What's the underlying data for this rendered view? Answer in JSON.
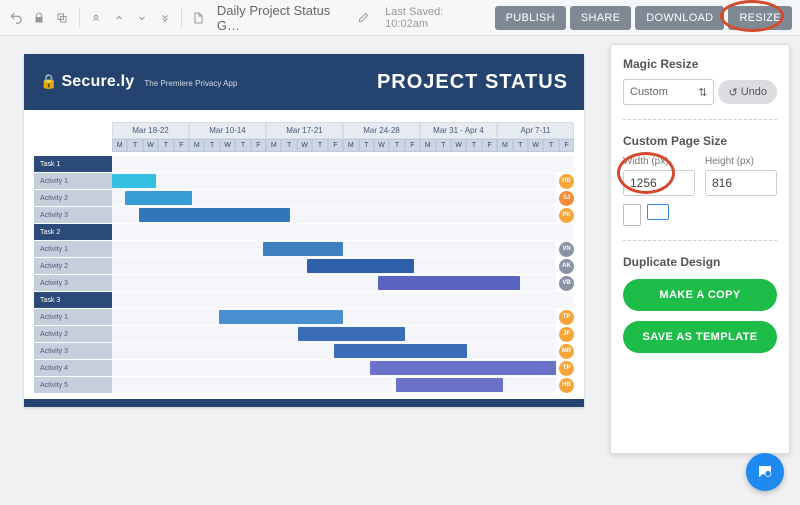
{
  "topbar": {
    "file_title": "Daily Project Status G…",
    "last_saved_label": "Last Saved:",
    "last_saved_time": "10:02am",
    "actions": {
      "publish": "PUBLISH",
      "share": "SHARE",
      "download": "DOWNLOAD",
      "resize": "RESIZE"
    }
  },
  "canvas": {
    "brand_name": "Secure.ly",
    "brand_tagline": "The Premiere Privacy App",
    "title": "PROJECT STATUS",
    "weeks": [
      "Mar 18-22",
      "Mar 10-14",
      "Mar 17-21",
      "Mar 24-28",
      "Mar 31 - Apr 4",
      "Apr 7-11"
    ],
    "days": [
      "M",
      "T",
      "W",
      "T",
      "F"
    ]
  },
  "gantt_rows": [
    {
      "label": "Task 1",
      "type": "head"
    },
    {
      "label": "Activity 1",
      "type": "sub",
      "badge": "HB",
      "badge_color": "#f7a53a",
      "bars": [
        {
          "start": 0,
          "end": 10,
          "color": "#35bfe0"
        }
      ]
    },
    {
      "label": "Activity 2",
      "type": "sub",
      "badge": "SJ",
      "badge_color": "#f58a3a",
      "bars": [
        {
          "start": 3,
          "end": 18,
          "color": "#3a9cd6"
        }
      ]
    },
    {
      "label": "Activity 3",
      "type": "sub",
      "badge": "PK",
      "badge_color": "#f7a53a",
      "bars": [
        {
          "start": 6,
          "end": 40,
          "color": "#2f77b8"
        }
      ]
    },
    {
      "label": "Task 2",
      "type": "head"
    },
    {
      "label": "Activity 1",
      "type": "sub",
      "badge": "VN",
      "badge_color": "#8a93a5",
      "bars": [
        {
          "start": 34,
          "end": 52,
          "color": "#3e7fc0"
        }
      ]
    },
    {
      "label": "Activity 2",
      "type": "sub",
      "badge": "AK",
      "badge_color": "#8a93a5",
      "bars": [
        {
          "start": 44,
          "end": 68,
          "color": "#2f5eaa"
        }
      ]
    },
    {
      "label": "Activity 3",
      "type": "sub",
      "badge": "VB",
      "badge_color": "#8a93a5",
      "bars": [
        {
          "start": 60,
          "end": 92,
          "color": "#5a63c0"
        }
      ]
    },
    {
      "label": "Task 3",
      "type": "head"
    },
    {
      "label": "Activity 1",
      "type": "sub",
      "badge": "TP",
      "badge_color": "#f7a53a",
      "bars": [
        {
          "start": 24,
          "end": 52,
          "color": "#4a8fd0"
        }
      ]
    },
    {
      "label": "Activity 2",
      "type": "sub",
      "badge": "JF",
      "badge_color": "#f7a53a",
      "bars": [
        {
          "start": 42,
          "end": 66,
          "color": "#3a6cb8"
        }
      ]
    },
    {
      "label": "Activity 3",
      "type": "sub",
      "badge": "MR",
      "badge_color": "#f7a53a",
      "bars": [
        {
          "start": 50,
          "end": 80,
          "color": "#3a6cb8"
        }
      ]
    },
    {
      "label": "Activity 4",
      "type": "sub",
      "badge": "TP",
      "badge_color": "#f7a53a",
      "bars": [
        {
          "start": 58,
          "end": 100,
          "color": "#6a73c8"
        }
      ]
    },
    {
      "label": "Activity 5",
      "type": "sub",
      "badge": "HB",
      "badge_color": "#f7a53a",
      "bars": [
        {
          "start": 64,
          "end": 88,
          "color": "#6a73c8"
        }
      ]
    }
  ],
  "panel": {
    "magic_resize_title": "Magic Resize",
    "resize_preset": "Custom",
    "undo_label": "Undo",
    "custom_title": "Custom Page Size",
    "width_label": "Width (px)",
    "height_label": "Height (px)",
    "width_value": "1256",
    "height_value": "816",
    "duplicate_title": "Duplicate Design",
    "make_copy": "MAKE A COPY",
    "save_template": "SAVE AS TEMPLATE"
  }
}
